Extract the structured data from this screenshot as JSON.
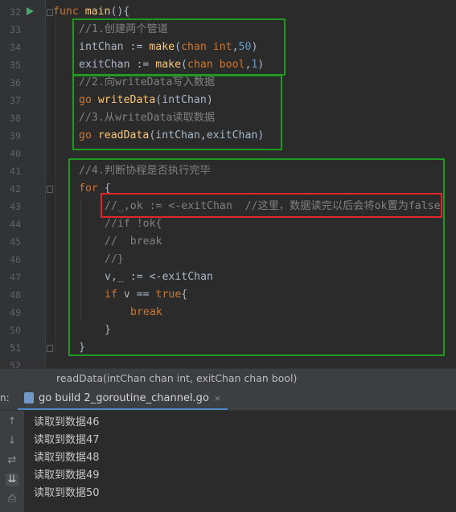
{
  "editor": {
    "line_numbers": [
      "32",
      "33",
      "34",
      "35",
      "36",
      "37",
      "38",
      "39",
      "40",
      "41",
      "42",
      "43",
      "44",
      "45",
      "46",
      "47",
      "48",
      "49",
      "50",
      "51",
      "52"
    ],
    "lines": [
      {
        "indent": 0,
        "tokens": [
          [
            "kw",
            "func "
          ],
          [
            "fn",
            "main"
          ],
          [
            "id",
            "(){"
          ]
        ]
      },
      {
        "indent": 1,
        "tokens": [
          [
            "cm",
            "//1.创建两个管道"
          ]
        ]
      },
      {
        "indent": 1,
        "tokens": [
          [
            "id",
            "intChan := "
          ],
          [
            "fn",
            "make"
          ],
          [
            "id",
            "("
          ],
          [
            "kw",
            "chan int"
          ],
          [
            "id",
            ","
          ],
          [
            "num",
            "50"
          ],
          [
            "id",
            ")"
          ]
        ]
      },
      {
        "indent": 1,
        "tokens": [
          [
            "id",
            "exitChan := "
          ],
          [
            "fn",
            "make"
          ],
          [
            "id",
            "("
          ],
          [
            "kw",
            "chan bool"
          ],
          [
            "id",
            ","
          ],
          [
            "num",
            "1"
          ],
          [
            "id",
            ")"
          ]
        ]
      },
      {
        "indent": 1,
        "tokens": [
          [
            "cm",
            "//2.向writeData写入数据"
          ]
        ]
      },
      {
        "indent": 1,
        "tokens": [
          [
            "kw",
            "go "
          ],
          [
            "fn",
            "writeData"
          ],
          [
            "id",
            "(intChan)"
          ]
        ]
      },
      {
        "indent": 1,
        "tokens": [
          [
            "cm",
            "//3.从writeData读取数据"
          ]
        ]
      },
      {
        "indent": 1,
        "tokens": [
          [
            "kw",
            "go "
          ],
          [
            "fn",
            "readData"
          ],
          [
            "id",
            "(intChan,exitChan)"
          ]
        ]
      },
      {
        "indent": 0,
        "tokens": []
      },
      {
        "indent": 1,
        "tokens": [
          [
            "cm",
            "//4.判断协程是否执行完毕"
          ]
        ]
      },
      {
        "indent": 1,
        "tokens": [
          [
            "kw",
            "for "
          ],
          [
            "id",
            "{"
          ]
        ]
      },
      {
        "indent": 2,
        "tokens": [
          [
            "cm",
            "//_,ok := <-exitChan  //这里，数据读完以后会将ok置为false"
          ]
        ]
      },
      {
        "indent": 2,
        "tokens": [
          [
            "cm",
            "//if !ok{"
          ]
        ]
      },
      {
        "indent": 2,
        "tokens": [
          [
            "cm",
            "//  break"
          ]
        ]
      },
      {
        "indent": 2,
        "tokens": [
          [
            "cm",
            "//}"
          ]
        ]
      },
      {
        "indent": 2,
        "tokens": [
          [
            "id",
            "v,_ := <-exitChan"
          ]
        ]
      },
      {
        "indent": 2,
        "tokens": [
          [
            "kw",
            "if "
          ],
          [
            "id",
            "v == "
          ],
          [
            "kw",
            "true"
          ],
          [
            "id",
            "{"
          ]
        ]
      },
      {
        "indent": 3,
        "tokens": [
          [
            "kw",
            "break"
          ]
        ]
      },
      {
        "indent": 2,
        "tokens": [
          [
            "id",
            "}"
          ]
        ]
      },
      {
        "indent": 1,
        "tokens": [
          [
            "id",
            "}"
          ]
        ]
      },
      {
        "indent": 0,
        "tokens": []
      }
    ]
  },
  "hint": {
    "signature": "readData(intChan chan int, exitChan chan bool)"
  },
  "run_panel": {
    "label": "n:",
    "tab_title": "go build 2_goroutine_channel.go",
    "close_glyph": "×",
    "output": [
      "读取到数据46",
      "读取到数据47",
      "读取到数据48",
      "读取到数据49",
      "读取到数据50"
    ]
  },
  "tools": [
    {
      "name": "up-arrow-icon",
      "glyph": "↑"
    },
    {
      "name": "down-arrow-icon",
      "glyph": "↓"
    },
    {
      "name": "soft-wrap-icon",
      "glyph": "⇄"
    },
    {
      "name": "scroll-to-end-icon",
      "glyph": "⇊"
    },
    {
      "name": "print-icon",
      "glyph": "⎙"
    }
  ],
  "colors": {
    "highlight_box_green": "#1f9a1f",
    "highlight_box_red": "#e0262a"
  }
}
